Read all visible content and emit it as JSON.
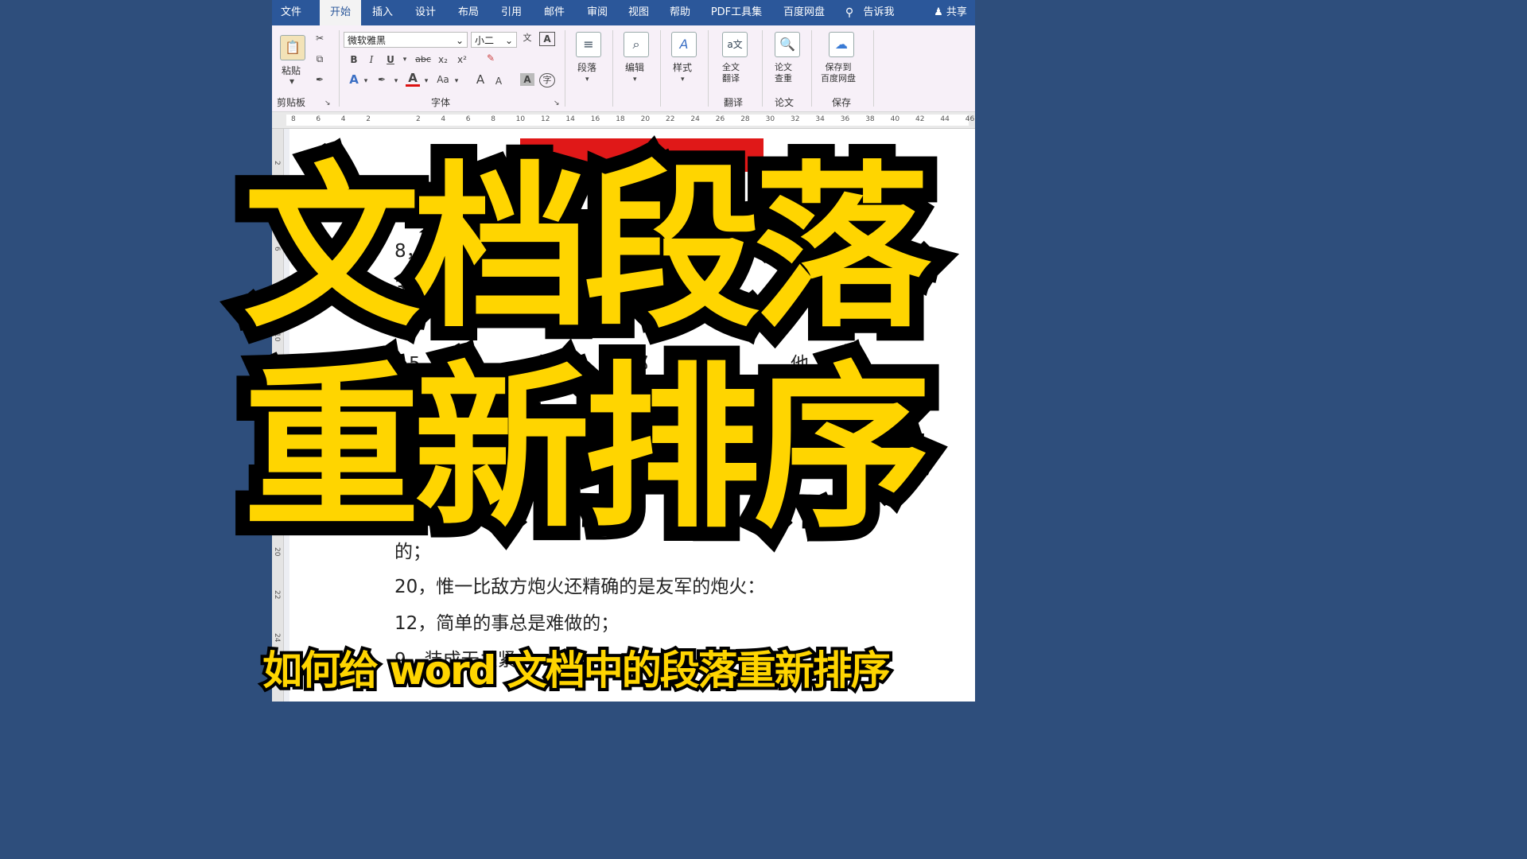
{
  "tabs": [
    "文件",
    "开始",
    "插入",
    "设计",
    "布局",
    "引用",
    "邮件",
    "审阅",
    "视图",
    "帮助",
    "PDF工具集",
    "百度网盘",
    "告诉我",
    "共享"
  ],
  "ribbon": {
    "clipboard": {
      "paste": "粘贴",
      "group": "剪贴板"
    },
    "font": {
      "name": "微软雅黑",
      "size": "小二",
      "group": "字体",
      "bold": "B",
      "italic": "I",
      "underline": "U",
      "strike": "abc",
      "sub": "x₂",
      "sup": "x²",
      "case": "Aa",
      "grow": "A",
      "shrink": "A",
      "wen": "文"
    },
    "paragraph": "段落",
    "editing": "编辑",
    "styles": "样式",
    "translate": {
      "button": "全文\n翻译",
      "group": "翻译"
    },
    "paper": {
      "button": "论文\n查重",
      "group": "论文"
    },
    "save": {
      "button": "保存到\n百度网盘",
      "group": "保存"
    }
  },
  "ruler_ticks": [
    "8",
    "6",
    "4",
    "2",
    "",
    "2",
    "4",
    "6",
    "8",
    "10",
    "12",
    "14",
    "16",
    "18",
    "20",
    "22",
    "24",
    "26",
    "28",
    "30",
    "32",
    "34",
    "36",
    "38",
    "40",
    "42",
    "44",
    "46"
  ],
  "vruler_ticks": [
    "2",
    "4",
    "6",
    "8",
    "10",
    "12",
    "14",
    "16",
    "18",
    "20",
    "22",
    "24",
    "26"
  ],
  "document": {
    "visible_fragments": [
      "8，自",
      "3，",
      "5，女",
      "力",
      "都",
      "心",
      "他",
      "的；"
    ],
    "lines": [
      "20，惟一比敌方炮火还精确的是友军的炮火：",
      "12，简单的事总是难做的；",
      "9，装成无关紧"
    ]
  },
  "overlay": {
    "title_line1": "文档段落",
    "title_line2": "重新排序",
    "subtitle": "如何给 word 文档中的段落重新排序"
  },
  "colors": {
    "background": "#2e4e7c",
    "tabbar": "#2b579a",
    "title_fill": "#ffd500",
    "title_stroke": "#000000",
    "banner": "#e01818"
  }
}
